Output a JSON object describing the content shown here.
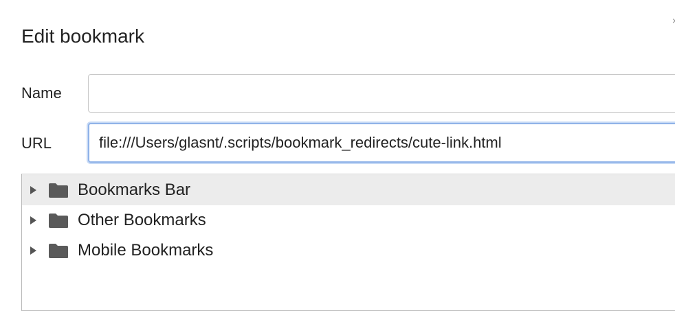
{
  "dialog": {
    "title": "Edit bookmark",
    "close_glyph": "×"
  },
  "form": {
    "name_label": "Name",
    "name_value": "",
    "url_label": "URL",
    "url_value": "file:///Users/glasnt/.scripts/bookmark_redirects/cute-link.html"
  },
  "folders": [
    {
      "label": "Bookmarks Bar",
      "icon": "folder-icon",
      "selected": true
    },
    {
      "label": "Other Bookmarks",
      "icon": "folder-icon",
      "selected": false
    },
    {
      "label": "Mobile Bookmarks",
      "icon": "folder-icon",
      "selected": false
    }
  ],
  "colors": {
    "focus_border": "#8fb2e8",
    "selected_row": "#ececec",
    "folder_icon": "#5a5a5a"
  }
}
